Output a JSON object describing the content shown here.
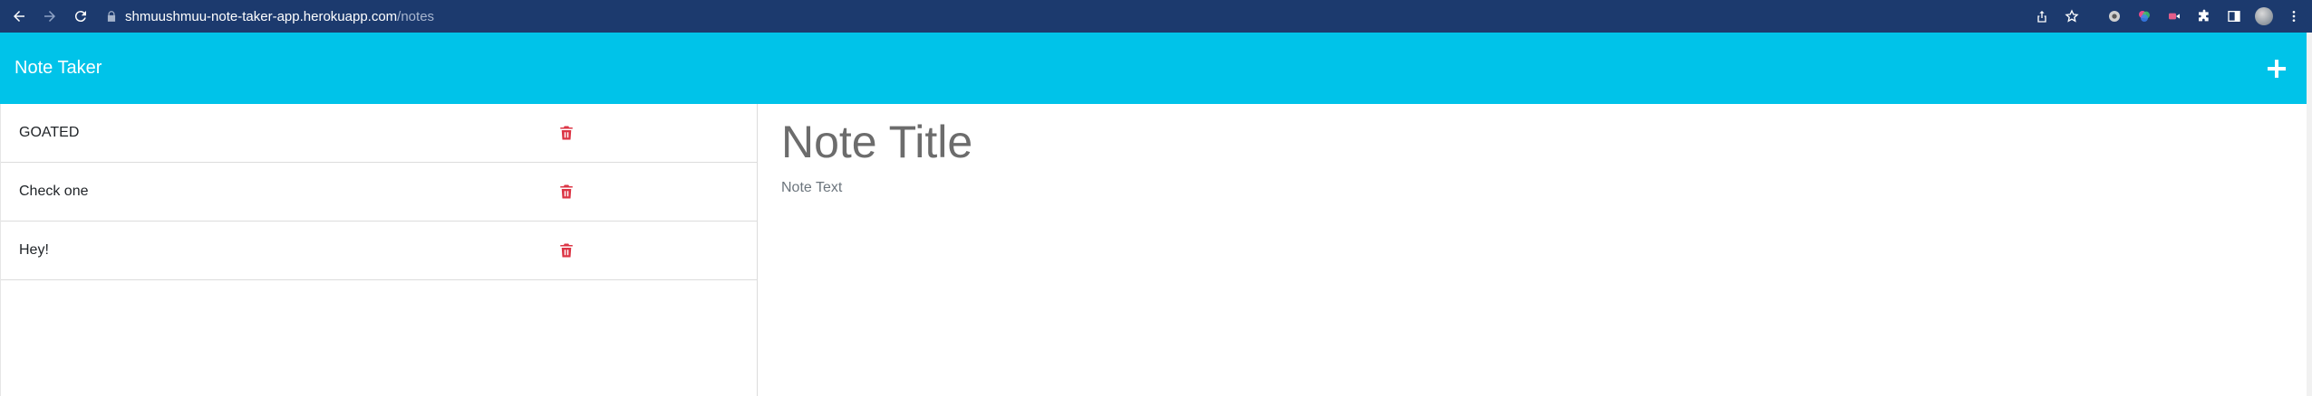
{
  "browser": {
    "url_host": "shmuushmuu-note-taker-app.herokuapp.com",
    "url_path": "/notes",
    "icons": [
      "back-icon",
      "forward-icon",
      "reload-icon",
      "lock-icon",
      "share-icon",
      "star-icon",
      "extension-icon",
      "color-picker-extension-icon",
      "video-extension-icon",
      "puzzle-icon",
      "sidebar-icon",
      "profile-avatar",
      "menu-icon"
    ]
  },
  "header": {
    "title": "Note Taker",
    "add_icon": "plus-icon",
    "background_color": "#00c3e9"
  },
  "notes": [
    {
      "title": "GOATED"
    },
    {
      "title": "Check one"
    },
    {
      "title": "Hey!"
    }
  ],
  "editor": {
    "title_placeholder": "Note Title",
    "text_placeholder": "Note Text"
  },
  "colors": {
    "trash": "#dc3545",
    "chrome": "#1c3a6e"
  }
}
